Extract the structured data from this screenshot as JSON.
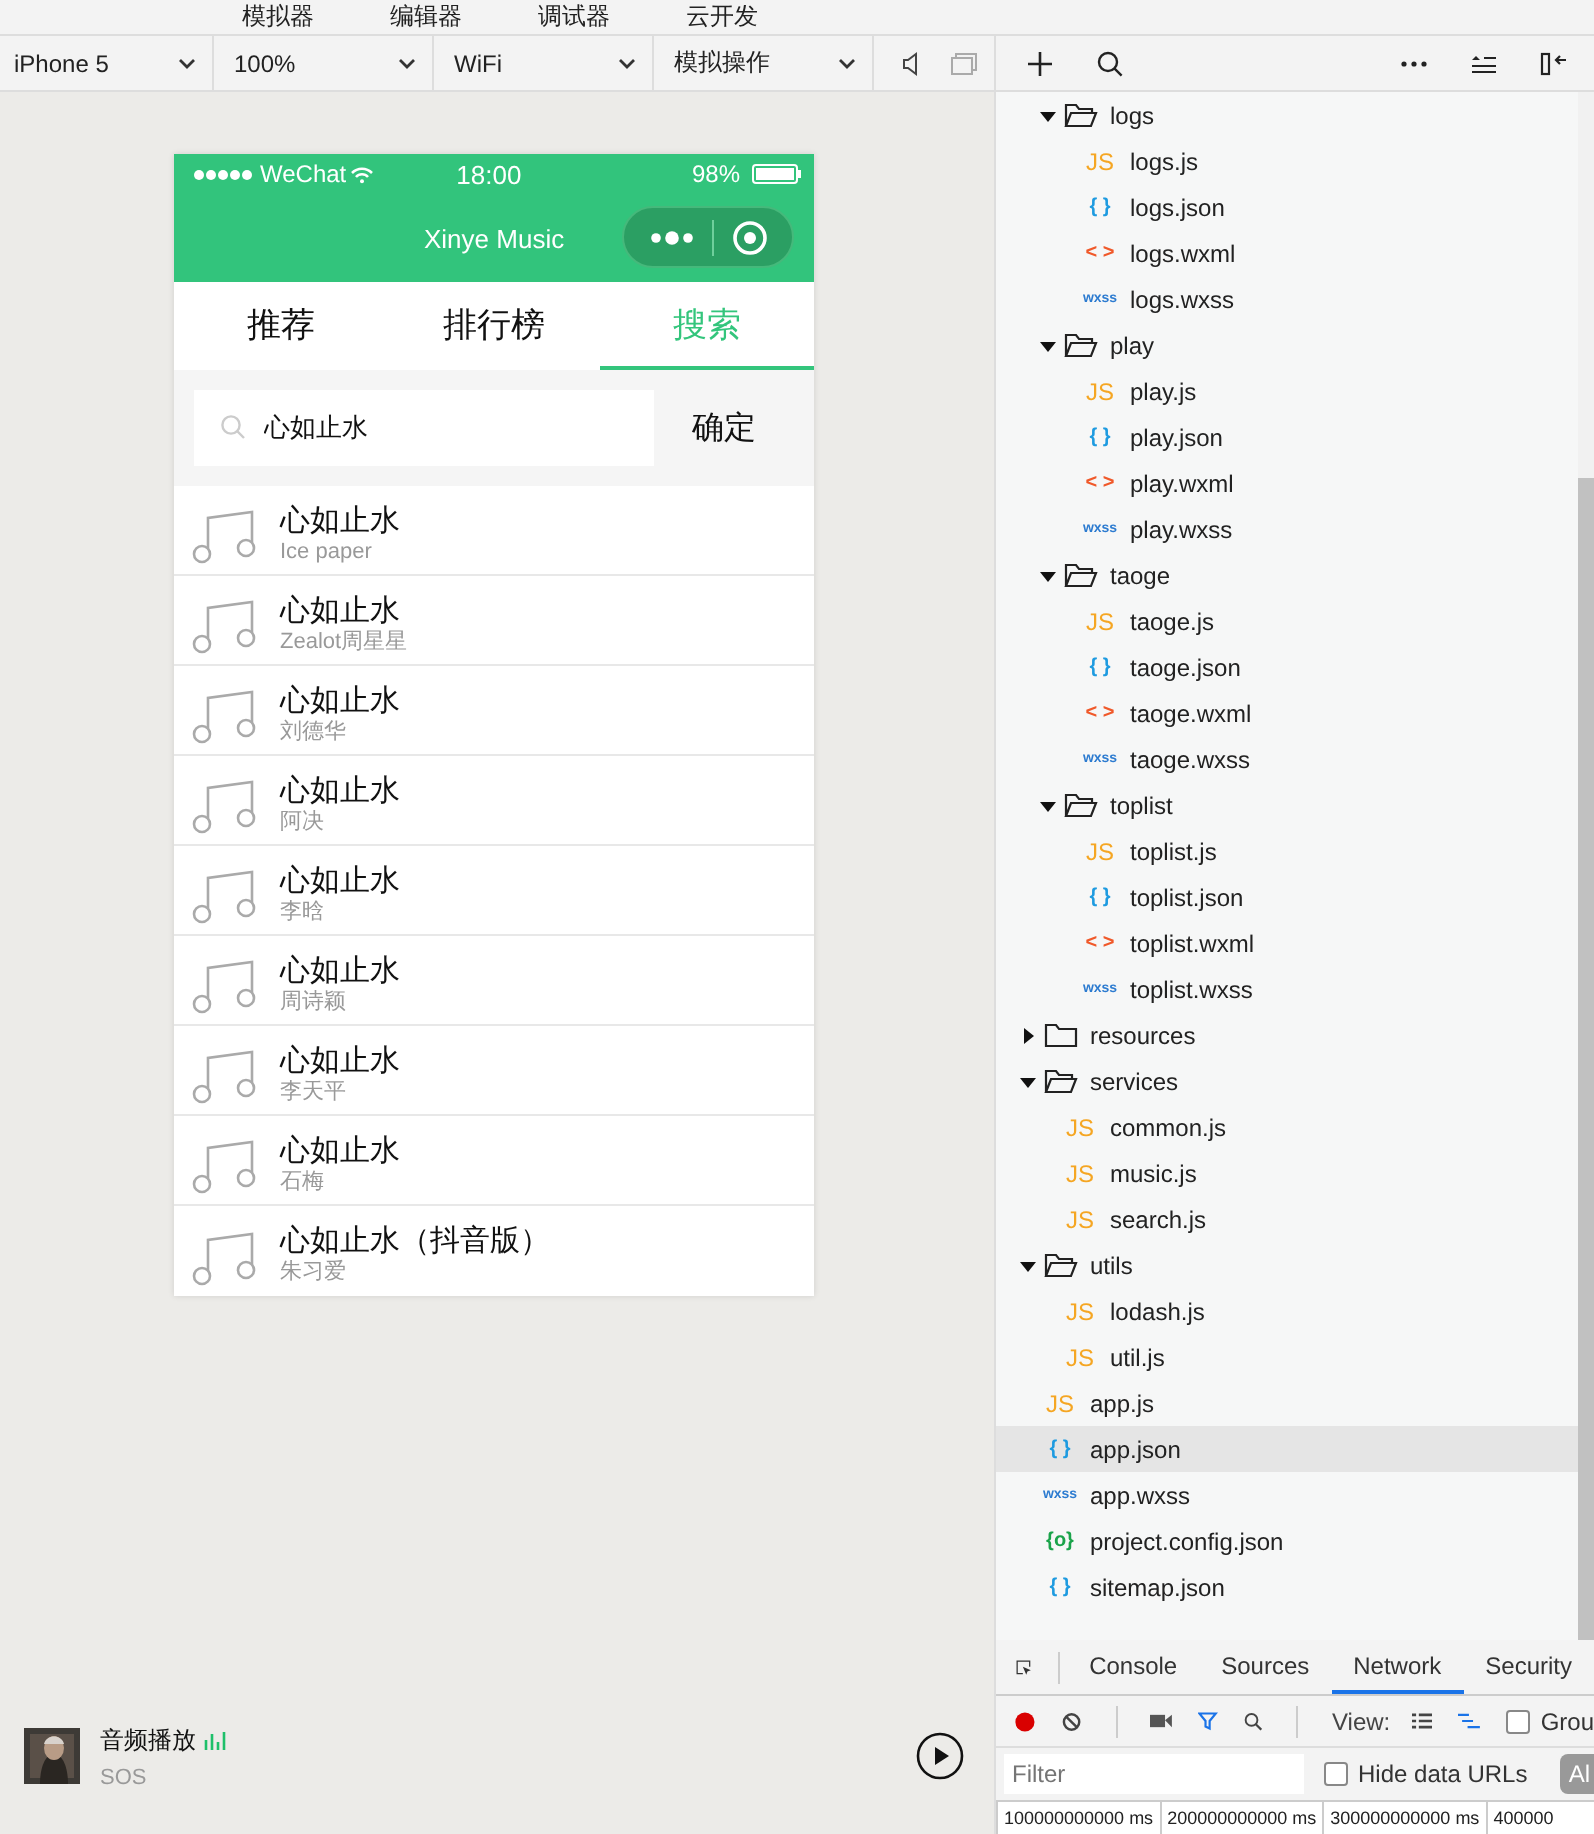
{
  "top_menu": [
    {
      "label": "模拟器"
    },
    {
      "label": "编辑器"
    },
    {
      "label": "调试器"
    },
    {
      "label": "云开发"
    }
  ],
  "sim_toolbar": {
    "selects": [
      {
        "value": "iPhone 5"
      },
      {
        "value": "100%"
      },
      {
        "value": "WiFi"
      },
      {
        "value": "模拟操作"
      }
    ]
  },
  "phone": {
    "status_bar": {
      "carrier": "WeChat",
      "time": "18:00",
      "battery": "98%"
    },
    "nav_title": "Xinye Music",
    "tabs": [
      {
        "label": "推荐",
        "selected": false
      },
      {
        "label": "排行榜",
        "selected": false
      },
      {
        "label": "搜索",
        "selected": true
      }
    ],
    "search": {
      "value": "心如止水",
      "button": "确定"
    },
    "songs": [
      {
        "title": "心如止水",
        "artist": "Ice paper"
      },
      {
        "title": "心如止水",
        "artist": "Zealot周星星"
      },
      {
        "title": "心如止水",
        "artist": "刘德华"
      },
      {
        "title": "心如止水",
        "artist": "阿决"
      },
      {
        "title": "心如止水",
        "artist": "李晗"
      },
      {
        "title": "心如止水",
        "artist": "周诗颖"
      },
      {
        "title": "心如止水",
        "artist": "李天平"
      },
      {
        "title": "心如止水",
        "artist": "石梅"
      },
      {
        "title": "心如止水（抖音版）",
        "artist": "朱习爱"
      }
    ]
  },
  "audio_player": {
    "title": "音频播放",
    "subtitle": "SOS"
  },
  "file_tree": {
    "continued_children": [
      {
        "name": "logs",
        "kind": "folder",
        "expanded": true,
        "children": [
          {
            "name": "logs.js",
            "kind": "js",
            "icon": "JS"
          },
          {
            "name": "logs.json",
            "kind": "json",
            "icon": "{ }"
          },
          {
            "name": "logs.wxml",
            "kind": "wxml",
            "icon": "< >"
          },
          {
            "name": "logs.wxss",
            "kind": "wxss",
            "icon": "wxss"
          }
        ]
      },
      {
        "name": "play",
        "kind": "folder",
        "expanded": true,
        "children": [
          {
            "name": "play.js",
            "kind": "js",
            "icon": "JS"
          },
          {
            "name": "play.json",
            "kind": "json",
            "icon": "{ }"
          },
          {
            "name": "play.wxml",
            "kind": "wxml",
            "icon": "< >"
          },
          {
            "name": "play.wxss",
            "kind": "wxss",
            "icon": "wxss"
          }
        ]
      },
      {
        "name": "taoge",
        "kind": "folder",
        "expanded": true,
        "children": [
          {
            "name": "taoge.js",
            "kind": "js",
            "icon": "JS"
          },
          {
            "name": "taoge.json",
            "kind": "json",
            "icon": "{ }"
          },
          {
            "name": "taoge.wxml",
            "kind": "wxml",
            "icon": "< >"
          },
          {
            "name": "taoge.wxss",
            "kind": "wxss",
            "icon": "wxss"
          }
        ]
      },
      {
        "name": "toplist",
        "kind": "folder",
        "expanded": true,
        "children": [
          {
            "name": "toplist.js",
            "kind": "js",
            "icon": "JS"
          },
          {
            "name": "toplist.json",
            "kind": "json",
            "icon": "{ }"
          },
          {
            "name": "toplist.wxml",
            "kind": "wxml",
            "icon": "< >"
          },
          {
            "name": "toplist.wxss",
            "kind": "wxss",
            "icon": "wxss"
          }
        ]
      }
    ],
    "items": [
      {
        "name": "resources",
        "kind": "folder",
        "expanded": false
      },
      {
        "name": "services",
        "kind": "folder",
        "expanded": true,
        "children": [
          {
            "name": "common.js",
            "kind": "js",
            "icon": "JS"
          },
          {
            "name": "music.js",
            "kind": "js",
            "icon": "JS"
          },
          {
            "name": "search.js",
            "kind": "js",
            "icon": "JS"
          }
        ]
      },
      {
        "name": "utils",
        "kind": "folder",
        "expanded": true,
        "children": [
          {
            "name": "lodash.js",
            "kind": "js",
            "icon": "JS"
          },
          {
            "name": "util.js",
            "kind": "js",
            "icon": "JS"
          }
        ]
      },
      {
        "name": "app.js",
        "kind": "js",
        "icon": "JS",
        "selected": false
      },
      {
        "name": "app.json",
        "kind": "json",
        "icon": "{ }",
        "selected": true
      },
      {
        "name": "app.wxss",
        "kind": "wxss",
        "icon": "wxss",
        "selected": false
      },
      {
        "name": "project.config.json",
        "kind": "config",
        "icon": "{o}",
        "selected": false
      },
      {
        "name": "sitemap.json",
        "kind": "json",
        "icon": "{ }",
        "selected": false
      }
    ]
  },
  "devtools": {
    "tabs": [
      {
        "label": "Console",
        "selected": false
      },
      {
        "label": "Sources",
        "selected": false
      },
      {
        "label": "Network",
        "selected": true
      },
      {
        "label": "Security",
        "selected": false
      }
    ],
    "view_label": "View:",
    "group_checkbox": {
      "label": "Grou",
      "checked": false
    },
    "filter": {
      "placeholder": "Filter"
    },
    "hide_data_urls": {
      "label": "Hide data URLs",
      "checked": false
    },
    "all_button": "Al",
    "timeline": [
      "100000000000 ms",
      "200000000000 ms",
      "300000000000 ms",
      "400000"
    ]
  }
}
